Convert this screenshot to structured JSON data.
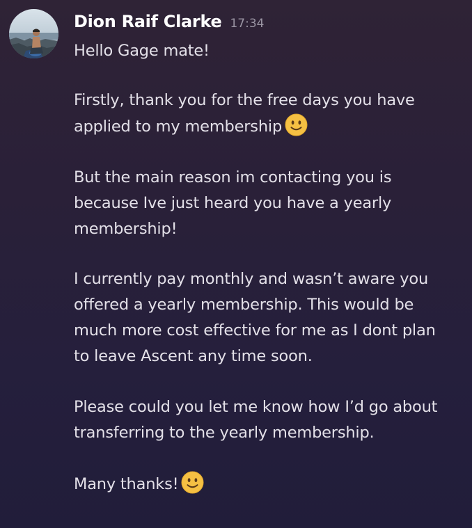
{
  "message": {
    "author": "Dion Raif Clarke",
    "time": "17:34",
    "avatar_icon": "user-avatar-photo",
    "paragraphs": [
      {
        "lines": [
          "Hello Gage mate!"
        ]
      },
      {
        "lines": [
          "Firstly, thank you for the free days you have",
          "applied to my membership"
        ],
        "trailing_emoji": "slightly-smiling-face"
      },
      {
        "lines": [
          "But the main reason im contacting you is",
          "because Ive just heard you have a yearly",
          "membership!"
        ]
      },
      {
        "lines": [
          "I currently pay monthly and wasn’t aware you",
          "offered a yearly membership. This would be",
          "much more cost effective for me as I dont plan",
          "to leave Ascent any time soon."
        ]
      },
      {
        "lines": [
          "Please could you let me know how I’d go about",
          "transferring to the yearly membership."
        ]
      },
      {
        "lines": [
          "Many thanks!"
        ],
        "trailing_emoji": "slightly-smiling-face"
      }
    ]
  },
  "colors": {
    "background_top": "#2f2336",
    "background_bottom": "#211d3a",
    "username": "#ffffff",
    "timestamp": "#9b96a4",
    "body_text": "#e3e0e8",
    "emoji_face": "#f5c043"
  }
}
